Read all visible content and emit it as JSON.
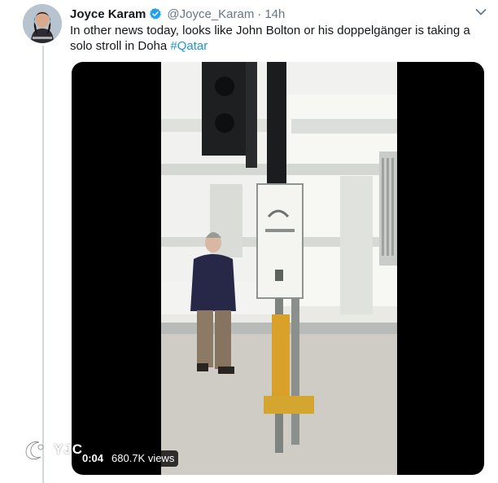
{
  "tweet": {
    "author_name": "Joyce Karam",
    "handle": "@Joyce_Karam",
    "separator": "·",
    "timestamp": "14h",
    "text_before": "In other news today, looks like John Bolton or his doppelgänger is taking a solo stroll in Doha ",
    "hashtag": "#Qatar"
  },
  "video": {
    "duration": "0:04",
    "views": "680.7K views"
  },
  "watermark": {
    "text": "YJC"
  },
  "colors": {
    "link": "#1b95e0",
    "verified": "#1da1f2",
    "secondary_text": "#657786"
  },
  "icons": {
    "verified": "verified-badge-icon",
    "more": "chevron-down-icon",
    "watermark_logo": "yjc-logo-icon"
  }
}
